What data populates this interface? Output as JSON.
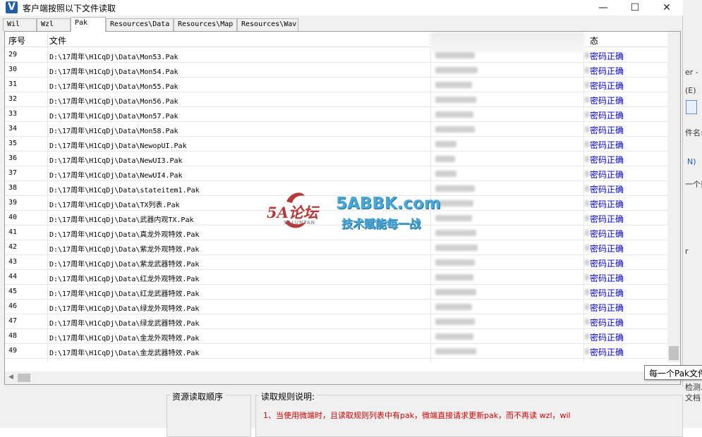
{
  "window": {
    "title": "客户端按照以下文件读取",
    "icon_letter": "V",
    "minimize_glyph": "—",
    "maximize_glyph": "☐",
    "close_glyph": "✕"
  },
  "tabs": [
    {
      "label": "Wil",
      "active": false
    },
    {
      "label": "Wzl",
      "active": false
    },
    {
      "label": "Pak",
      "active": true
    },
    {
      "label": "Resources\\Data",
      "active": false
    },
    {
      "label": "Resources\\Map",
      "active": false
    },
    {
      "label": "Resources\\Wav",
      "active": false
    }
  ],
  "table": {
    "columns": [
      "序号",
      "文件",
      "态"
    ],
    "rows": [
      {
        "no": "29",
        "path": "D:\\17周年\\H1CqDj\\Data\\Mon53.Pak",
        "status": "密码正确"
      },
      {
        "no": "30",
        "path": "D:\\17周年\\H1CqDj\\Data\\Mon54.Pak",
        "status": "密码正确"
      },
      {
        "no": "31",
        "path": "D:\\17周年\\H1CqDj\\Data\\Mon55.Pak",
        "status": "密码正确"
      },
      {
        "no": "32",
        "path": "D:\\17周年\\H1CqDj\\Data\\Mon56.Pak",
        "status": "密码正确"
      },
      {
        "no": "33",
        "path": "D:\\17周年\\H1CqDj\\Data\\Mon57.Pak",
        "status": "密码正确"
      },
      {
        "no": "34",
        "path": "D:\\17周年\\H1CqDj\\Data\\Mon58.Pak",
        "status": "密码正确"
      },
      {
        "no": "35",
        "path": "D:\\17周年\\H1CqDj\\Data\\NewopUI.Pak",
        "status": "密码正确"
      },
      {
        "no": "36",
        "path": "D:\\17周年\\H1CqDj\\Data\\NewUI3.Pak",
        "status": "密码正确"
      },
      {
        "no": "37",
        "path": "D:\\17周年\\H1CqDj\\Data\\NewUI4.Pak",
        "status": "密码正确"
      },
      {
        "no": "38",
        "path": "D:\\17周年\\H1CqDj\\Data\\stateitem1.Pak",
        "status": "密码正确"
      },
      {
        "no": "39",
        "path": "D:\\17周年\\H1CqDj\\Data\\TX列表.Pak",
        "status": "密码正确"
      },
      {
        "no": "40",
        "path": "D:\\17周年\\H1CqDj\\Data\\武器内观TX.Pak",
        "status": "密码正确"
      },
      {
        "no": "41",
        "path": "D:\\17周年\\H1CqDj\\Data\\真龙外观特效.Pak",
        "status": "密码正确"
      },
      {
        "no": "42",
        "path": "D:\\17周年\\H1CqDj\\Data\\紫龙外观特效.Pak",
        "status": "密码正确"
      },
      {
        "no": "43",
        "path": "D:\\17周年\\H1CqDj\\Data\\紫龙武器特效.Pak",
        "status": "密码正确"
      },
      {
        "no": "44",
        "path": "D:\\17周年\\H1CqDj\\Data\\红龙外观特效.Pak",
        "status": "密码正确"
      },
      {
        "no": "45",
        "path": "D:\\17周年\\H1CqDj\\Data\\红龙武器特效.Pak",
        "status": "密码正确"
      },
      {
        "no": "46",
        "path": "D:\\17周年\\H1CqDj\\Data\\绿龙外观特效.Pak",
        "status": "密码正确"
      },
      {
        "no": "47",
        "path": "D:\\17周年\\H1CqDj\\Data\\绿龙武器特效.Pak",
        "status": "密码正确"
      },
      {
        "no": "48",
        "path": "D:\\17周年\\H1CqDj\\Data\\金龙外观特效.Pak",
        "status": "密码正确"
      },
      {
        "no": "49",
        "path": "D:\\17周年\\H1CqDj\\Data\\金龙武器特效.Pak",
        "status": "密码正确"
      }
    ]
  },
  "tooltip": "每一个Pak文件",
  "bottom": {
    "order_group_title": "资源读取顺序",
    "rules_group_title": "读取规则说明:",
    "rule_1": "1、当使用微端时，且读取规则列表中有pak，微端直接请求更新pak，而不再读 wzl，wil"
  },
  "watermark": {
    "brand": "5A论坛",
    "sub": "SALUNTAN",
    "domain": "5ABBK.com",
    "slogan": "技术赋能每一战"
  },
  "background_app": {
    "texts": [
      "er -",
      "(E)",
      "件名:",
      "N)",
      "一个或",
      "r",
      "检测.",
      "文档"
    ]
  },
  "colors": {
    "status_text": "#0000cc",
    "rule_text": "#cc0000",
    "watermark_red": "#b73a3a",
    "watermark_blue": "#4aa8d8"
  }
}
